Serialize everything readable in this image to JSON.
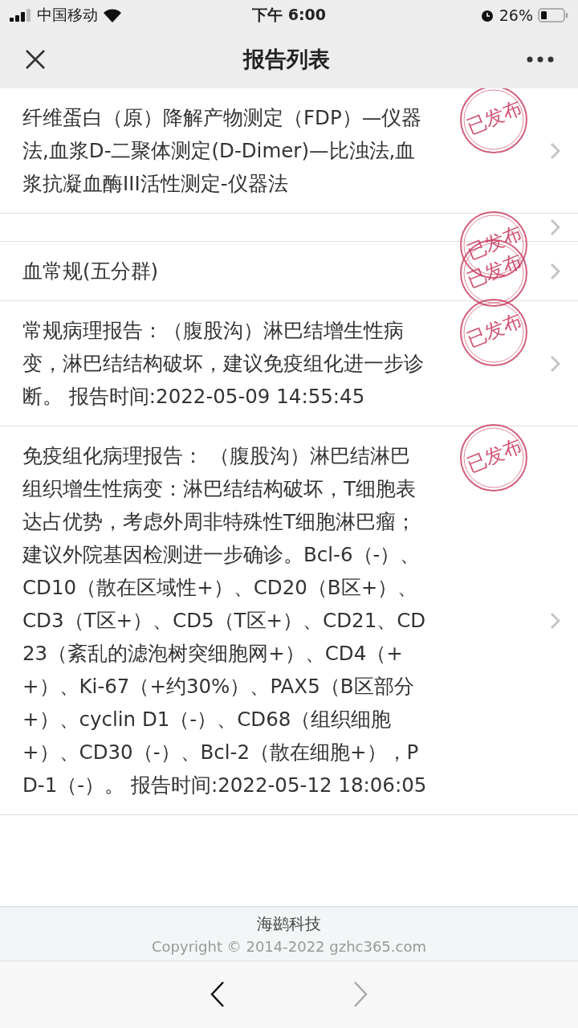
{
  "status_bar": {
    "carrier": "中国移动",
    "time": "下午 6:00",
    "battery": "26%"
  },
  "nav": {
    "title": "报告列表"
  },
  "reports": [
    {
      "text": "纤维蛋白（原）降解产物测定（FDP）—仪器法,血浆D-二聚体测定(D-Dimer)—比浊法,血浆抗凝血酶III活性测定-仪器法",
      "stamp": "已发布"
    },
    {
      "stamp": "已发布"
    },
    {
      "text": "血常规(五分群)",
      "stamp": "已发布"
    },
    {
      "text": "常规病理报告：（腹股沟）淋巴结增生性病变，淋巴结结构破坏，建议免疫组化进一步诊断。 报告时间:2022-05-09 14:55:45",
      "stamp": "已发布"
    },
    {
      "text": "免疫组化病理报告： （腹股沟）淋巴结淋巴组织增生性病变：淋巴结结构破坏，T细胞表达占优势，考虑外周非特殊性T细胞淋巴瘤；建议外院基因检测进一步确诊。Bcl-6（-）、CD10（散在区域性+）、CD20（B区+）、CD3（T区+）、CD5（T区+）、CD21、CD23（紊乱的滤泡树突细胞网+）、CD4（++）、Ki-67（+约30%）、PAX5（B区部分+）、cyclin D1（-）、CD68（组织细胞+）、CD30（-）、Bcl-2（散在细胞+），PD-1（-）。 报告时间:2022-05-12 18:06:05",
      "stamp": "已发布"
    }
  ],
  "footer": {
    "company": "海鹚科技",
    "copyright": "Copyright © 2014-2022 gzhc365.com"
  },
  "toolbar": {
    "back_disabled": false,
    "forward_disabled": true
  }
}
